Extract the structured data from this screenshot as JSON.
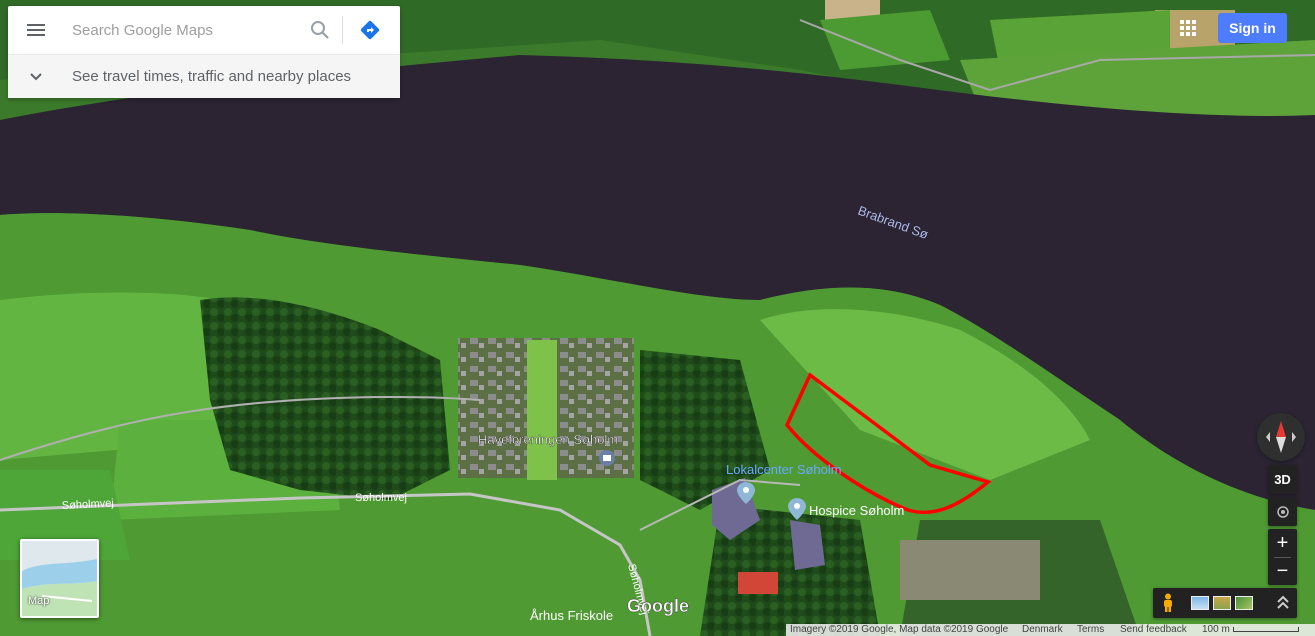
{
  "search": {
    "placeholder": "Search Google Maps",
    "travel_text": "See travel times, traffic and nearby places"
  },
  "header": {
    "sign_in_label": "Sign in"
  },
  "map": {
    "labels": {
      "lake": "Brabrand Sø",
      "allotment": "Haveforeningen Søholm",
      "lokalcenter": "Lokalcenter Søholm",
      "hospice": "Hospice Søholm",
      "road_main_1": "Søholmvej",
      "road_main_2": "Søholmvej",
      "road_side": "Søholmvej",
      "school": "Århus Friskole",
      "logo": "Google"
    },
    "highlight_color": "#ff0000",
    "icons": [
      "garden-place-icon",
      "place-pin-icon"
    ]
  },
  "controls": {
    "three_d_label": "3D",
    "zoom_in_label": "+",
    "zoom_out_label": "−",
    "layer_label": "Map"
  },
  "footer": {
    "imagery": "Imagery ©2019 Google, Map data ©2019 Google",
    "country": "Denmark",
    "terms": "Terms",
    "feedback": "Send feedback",
    "scale": "100 m"
  },
  "colors": {
    "accent": "#4d7cfe",
    "directions": "#1a73e8",
    "water": "#2c2433",
    "grass": "#3f8a2a"
  }
}
